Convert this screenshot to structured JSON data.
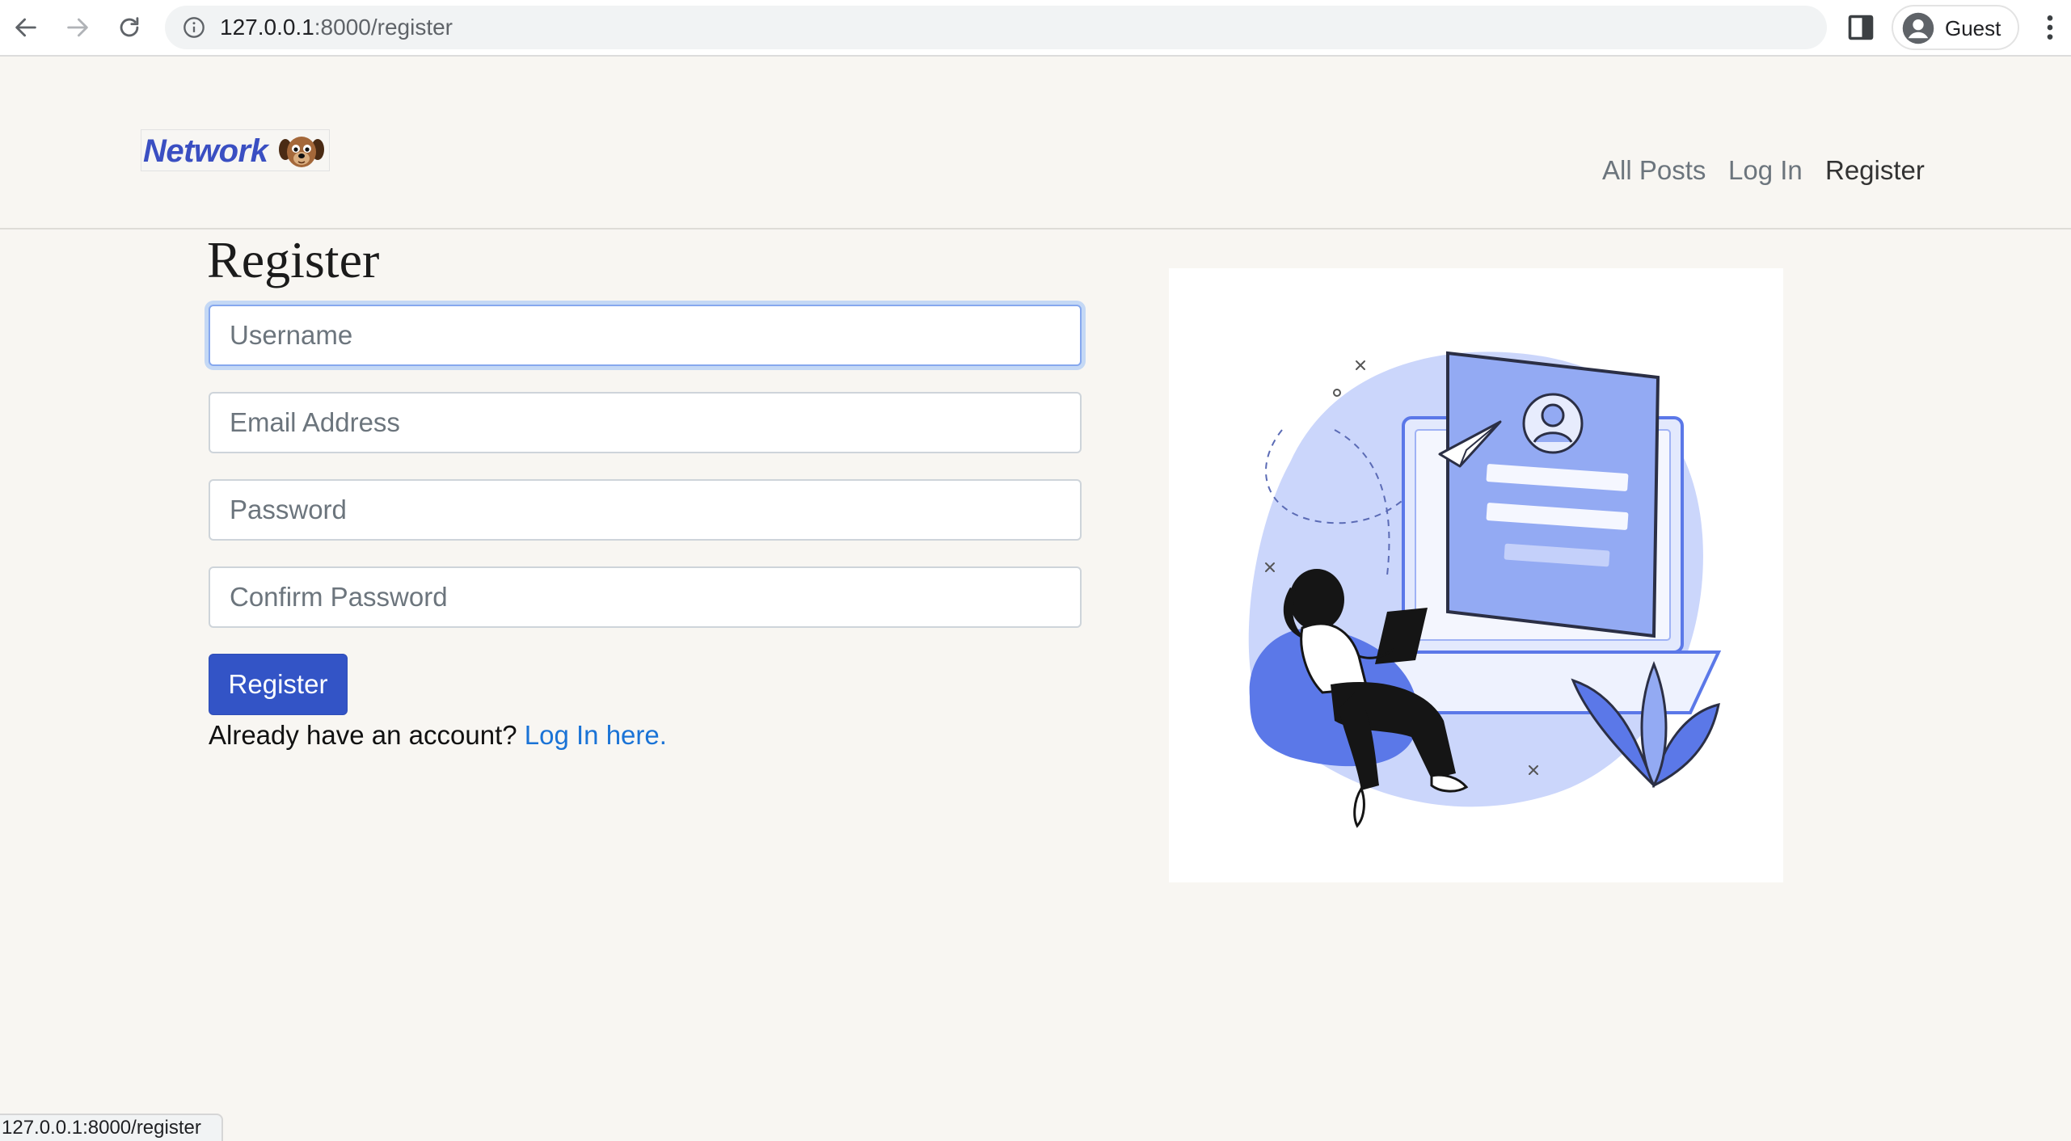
{
  "browser": {
    "url_host": "127.0.0.1",
    "url_path": ":8000/register",
    "profile_name": "Guest",
    "status_url": "127.0.0.1:8000/register"
  },
  "site": {
    "brand": "Network",
    "nav": {
      "all_posts": "All Posts",
      "log_in": "Log In",
      "register": "Register"
    }
  },
  "form": {
    "title": "Register",
    "username_placeholder": "Username",
    "email_placeholder": "Email Address",
    "password_placeholder": "Password",
    "confirm_placeholder": "Confirm Password",
    "submit_label": "Register",
    "login_prompt": "Already have an account?",
    "login_link": "Log In here."
  },
  "colors": {
    "brand": "#3a4fc2",
    "primary_button": "#3354c6",
    "link": "#1a73d6",
    "page_bg": "#f8f6f2",
    "illustration_accent": "#5b78e8"
  }
}
